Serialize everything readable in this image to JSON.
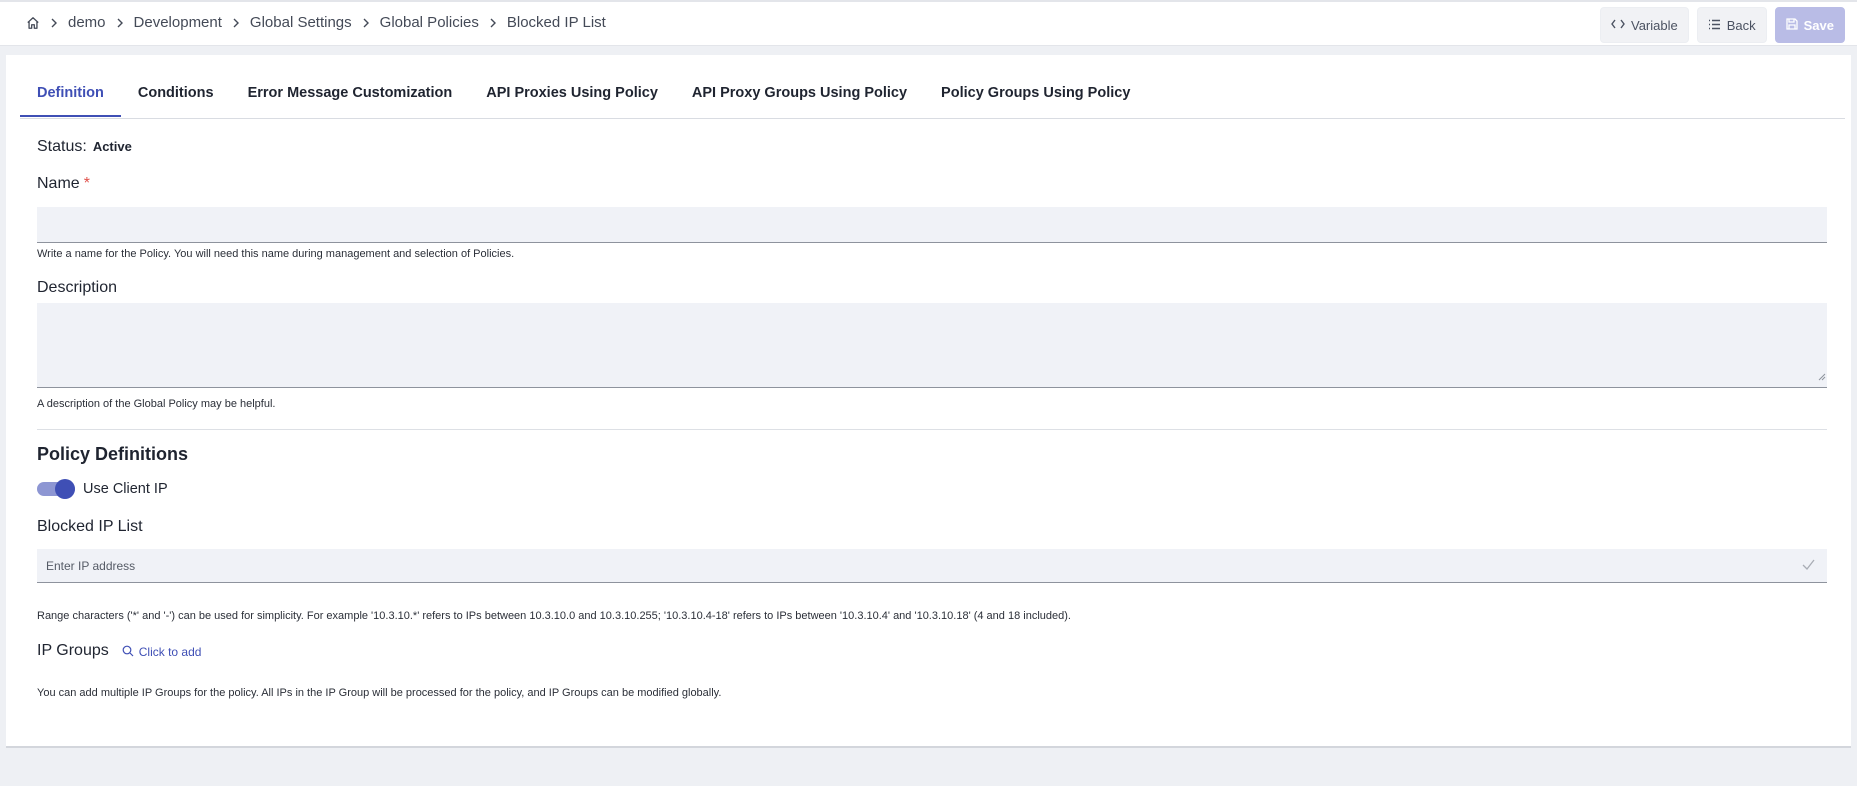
{
  "breadcrumb": {
    "items": [
      "demo",
      "Development",
      "Global Settings",
      "Global Policies",
      "Blocked IP List"
    ]
  },
  "header_actions": {
    "variable_label": "Variable",
    "back_label": "Back",
    "save_label": "Save"
  },
  "tabs": [
    {
      "label": "Definition",
      "active": true
    },
    {
      "label": "Conditions"
    },
    {
      "label": "Error Message Customization"
    },
    {
      "label": "API Proxies Using Policy"
    },
    {
      "label": "API Proxy Groups Using Policy"
    },
    {
      "label": "Policy Groups Using Policy"
    }
  ],
  "form": {
    "status_label": "Status:",
    "status_value": "Active",
    "name_label": "Name",
    "name_required": "*",
    "name_value": "",
    "name_help": "Write a name for the Policy. You will need this name during management and selection of Policies.",
    "description_label": "Description",
    "description_value": "",
    "description_help": "A description of the Global Policy may be helpful.",
    "policy_definitions_title": "Policy Definitions",
    "use_client_ip_label": "Use Client IP",
    "use_client_ip_enabled": true,
    "blocked_ip_label": "Blocked IP List",
    "blocked_ip_placeholder": "Enter IP address",
    "blocked_ip_help": "Range characters ('*' and '-') can be used for simplicity. For example '10.3.10.*' refers to IPs between 10.3.10.0 and 10.3.10.255; '10.3.10.4-18' refers to IPs between '10.3.10.4' and '10.3.10.18' (4 and 18 included).",
    "ip_groups_label": "IP Groups",
    "ip_groups_add_label": "Click to add",
    "ip_groups_help": "You can add multiple IP Groups for the policy. All IPs in the IP Group will be processed for the policy, and IP Groups can be modified globally."
  },
  "colors": {
    "accent": "#3f4fb5",
    "save_disabled": "#b9bce6",
    "input_bg": "#f0f2f7",
    "page_bg": "#eef0f4"
  }
}
